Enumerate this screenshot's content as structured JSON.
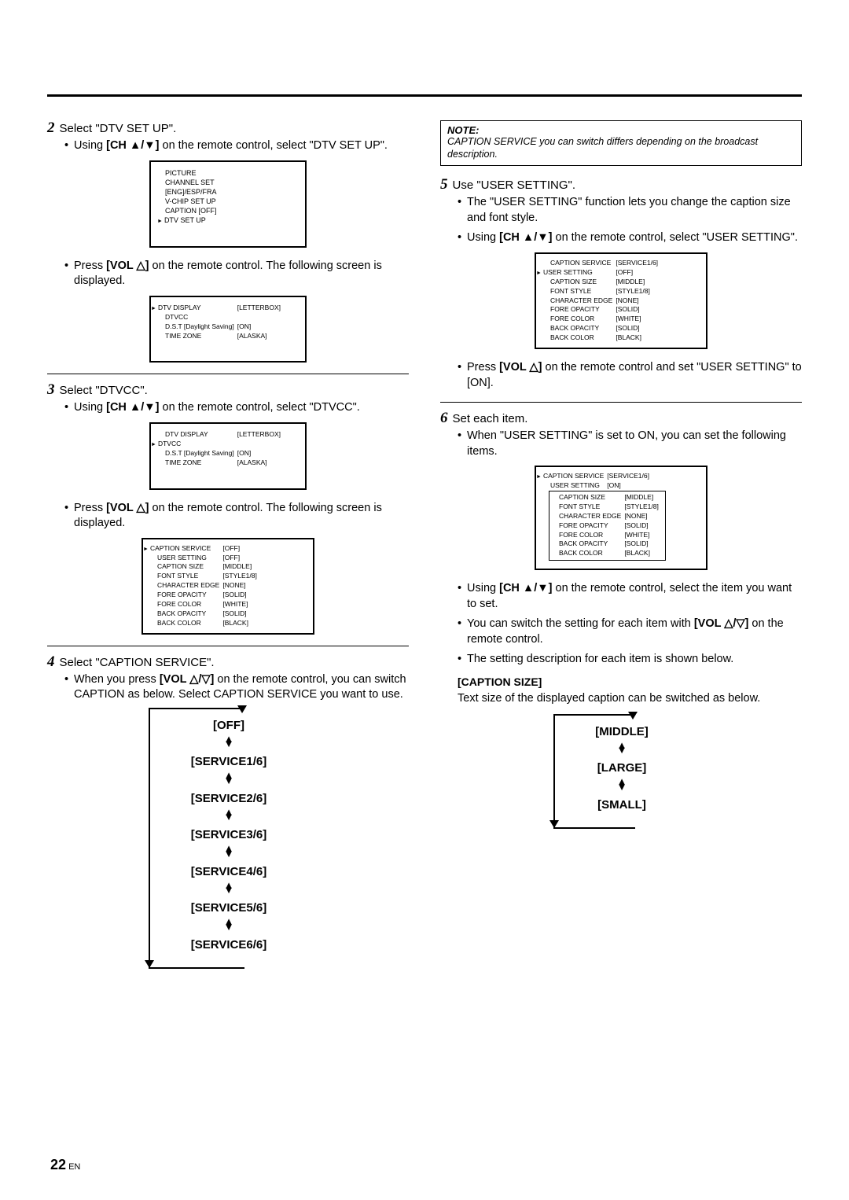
{
  "pageNumber": "22",
  "pageNumberSuffix": "EN",
  "bold_ch": "[CH ▲/▼]",
  "bold_vol_tri": "[VOL △]",
  "bold_vol_tritri": "[VOL △/▽]",
  "left": {
    "step2": {
      "num": "2",
      "title": "Select \"DTV SET UP\".",
      "item1_a": "Using ",
      "item1_b": " on the remote control, select \"DTV SET UP\".",
      "menu1": {
        "l1": "PICTURE",
        "l2": "CHANNEL SET",
        "l3": "[ENG]/ESP/FRA",
        "l4": "V-CHIP SET UP",
        "l5": "CAPTION [OFF]",
        "l6": "DTV SET UP"
      },
      "item2_a": "Press ",
      "item2_b": " on the remote control. The following screen is displayed.",
      "menu2": {
        "l1a": "DTV DISPLAY",
        "l1b": "[LETTERBOX]",
        "l2a": "DTVCC",
        "l2b": "",
        "l3a": "D.S.T [Daylight Saving]",
        "l3b": "[ON]",
        "l4a": "TIME ZONE",
        "l4b": "[ALASKA]"
      }
    },
    "step3": {
      "num": "3",
      "title": "Select \"DTVCC\".",
      "item1_a": "Using ",
      "item1_b": " on the remote control, select \"DTVCC\".",
      "menu1": {
        "l1a": "DTV DISPLAY",
        "l1b": "[LETTERBOX]",
        "l2a": "DTVCC",
        "l2b": "",
        "l3a": "D.S.T [Daylight Saving]",
        "l3b": "[ON]",
        "l4a": "TIME ZONE",
        "l4b": "[ALASKA]"
      },
      "item2_a": "Press ",
      "item2_b": " on the remote control. The following screen is displayed.",
      "menu2": {
        "r1a": "CAPTION SERVICE",
        "r1b": "[OFF]",
        "r2a": "USER SETTING",
        "r2b": "[OFF]",
        "r3a": "CAPTION SIZE",
        "r3b": "[MIDDLE]",
        "r4a": "FONT STYLE",
        "r4b": "[STYLE1/8]",
        "r5a": "CHARACTER EDGE",
        "r5b": "[NONE]",
        "r6a": "FORE OPACITY",
        "r6b": "[SOLID]",
        "r7a": "FORE COLOR",
        "r7b": "[WHITE]",
        "r8a": "BACK OPACITY",
        "r8b": "[SOLID]",
        "r9a": "BACK COLOR",
        "r9b": "[BLACK]"
      }
    },
    "step4": {
      "num": "4",
      "title": "Select \"CAPTION SERVICE\".",
      "item1_a": "When you press ",
      "item1_b": " on the remote control, you can switch CAPTION as below. Select CAPTION SERVICE you want to use.",
      "cycle": [
        "[OFF]",
        "[SERVICE1/6]",
        "[SERVICE2/6]",
        "[SERVICE3/6]",
        "[SERVICE4/6]",
        "[SERVICE5/6]",
        "[SERVICE6/6]"
      ]
    }
  },
  "right": {
    "note": {
      "title": "NOTE:",
      "text": "CAPTION SERVICE you can switch differs depending on the broadcast description."
    },
    "step5": {
      "num": "5",
      "title": "Use \"USER SETTING\".",
      "item1": "The \"USER SETTING\" function lets you change the caption size and font style.",
      "item2_a": "Using ",
      "item2_b": " on the remote control, select \"USER SETTING\".",
      "menu": {
        "r1a": "CAPTION SERVICE",
        "r1b": "[SERVICE1/6]",
        "r2a": "USER SETTING",
        "r2b": "[OFF]",
        "r3a": "CAPTION SIZE",
        "r3b": "[MIDDLE]",
        "r4a": "FONT STYLE",
        "r4b": "[STYLE1/8]",
        "r5a": "CHARACTER EDGE",
        "r5b": "[NONE]",
        "r6a": "FORE OPACITY",
        "r6b": "[SOLID]",
        "r7a": "FORE COLOR",
        "r7b": "[WHITE]",
        "r8a": "BACK OPACITY",
        "r8b": "[SOLID]",
        "r9a": "BACK COLOR",
        "r9b": "[BLACK]"
      },
      "item3_a": "Press ",
      "item3_b": " on the remote control and set \"USER SETTING\" to [ON]."
    },
    "step6": {
      "num": "6",
      "title": "Set each item.",
      "item1": "When \"USER SETTING\" is set to ON, you can set the following items.",
      "menu": {
        "r1a": "CAPTION SERVICE",
        "r1b": "[SERVICE1/6]",
        "r2a": "USER SETTING",
        "r2b": "[ON]",
        "r3a": "CAPTION SIZE",
        "r3b": "[MIDDLE]",
        "r4a": "FONT STYLE",
        "r4b": "[STYLE1/8]",
        "r5a": "CHARACTER EDGE",
        "r5b": "[NONE]",
        "r6a": "FORE OPACITY",
        "r6b": "[SOLID]",
        "r7a": "FORE COLOR",
        "r7b": "[WHITE]",
        "r8a": "BACK OPACITY",
        "r8b": "[SOLID]",
        "r9a": "BACK COLOR",
        "r9b": "[BLACK]"
      },
      "item2_a": "Using ",
      "item2_b": " on the remote control, select the item you want to set.",
      "item3_a": "You can switch the setting for each item with ",
      "item3_b": " on the remote control.",
      "item4": "The setting description for each item is shown below.",
      "sectionLabel": "[CAPTION SIZE]",
      "sectionDesc": "Text size of the displayed caption can be switched as below.",
      "cycle": [
        "[MIDDLE]",
        "[LARGE]",
        "[SMALL]"
      ]
    }
  }
}
